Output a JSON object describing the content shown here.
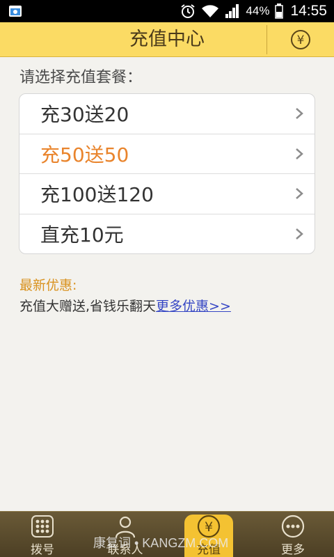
{
  "status_bar": {
    "battery_percent": "44%",
    "time": "14:55"
  },
  "header": {
    "title": "充值中心",
    "yuan_symbol": "¥"
  },
  "prompt": "请选择充值套餐：",
  "packages": [
    {
      "label": "充30送20",
      "highlighted": false
    },
    {
      "label": "充50送50",
      "highlighted": true
    },
    {
      "label": "充100送120",
      "highlighted": false
    },
    {
      "label": "直充10元",
      "highlighted": false
    }
  ],
  "promo": {
    "title": "最新优惠:",
    "text": "充值大赠送,省钱乐翻天",
    "link": "更多优惠>>"
  },
  "bottom_nav": [
    {
      "label": "拨号",
      "icon": "dialpad-icon"
    },
    {
      "label": "联系人",
      "icon": "contacts-icon"
    },
    {
      "label": "充值",
      "icon": "yuan-icon",
      "active": true
    },
    {
      "label": "更多",
      "icon": "more-icon"
    }
  ],
  "watermark": "康复词 • KANGZM.COM",
  "colors": {
    "header_bg": "#fbdb64",
    "highlight": "#e9842c",
    "promo_title": "#d9921f",
    "link": "#3546c4",
    "nav_active": "#f4c232"
  }
}
